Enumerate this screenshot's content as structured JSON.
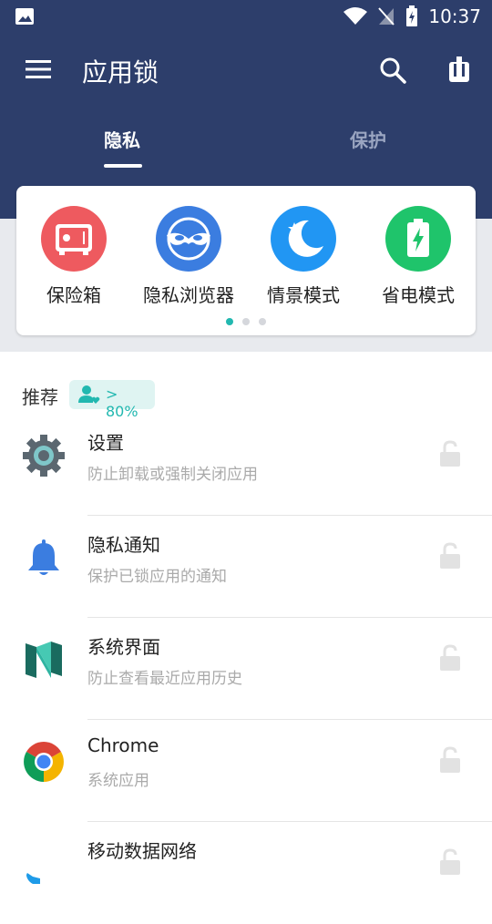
{
  "status_bar": {
    "time": "10:37"
  },
  "app_bar": {
    "title": "应用锁"
  },
  "tabs": [
    {
      "label": "隐私"
    },
    {
      "label": "保护"
    }
  ],
  "features": [
    {
      "label": "保险箱",
      "color": "#ee5a5f",
      "icon": "safe-icon"
    },
    {
      "label": "隐私浏览器",
      "color": "#3b7de0",
      "icon": "mask-icon"
    },
    {
      "label": "情景模式",
      "color": "#2196f3",
      "icon": "moon-star-icon"
    },
    {
      "label": "省电模式",
      "color": "#1fc46b",
      "icon": "battery-icon"
    }
  ],
  "recommend": {
    "label": "推荐",
    "badge": "> 80%"
  },
  "apps": [
    {
      "name": "设置",
      "desc": "防止卸载或强制关闭应用",
      "icon": "gear-icon"
    },
    {
      "name": "隐私通知",
      "desc": "保护已锁应用的通知",
      "icon": "bell-icon"
    },
    {
      "name": "系统界面",
      "desc": "防止查看最近应用历史",
      "icon": "nougat-icon"
    },
    {
      "name": "Chrome",
      "desc": "系统应用",
      "icon": "chrome-icon"
    },
    {
      "name": "移动数据网络",
      "desc": "",
      "icon": "phone-icon"
    }
  ],
  "colors": {
    "primary": "#2d3e6b",
    "accent": "#22b8b0"
  }
}
